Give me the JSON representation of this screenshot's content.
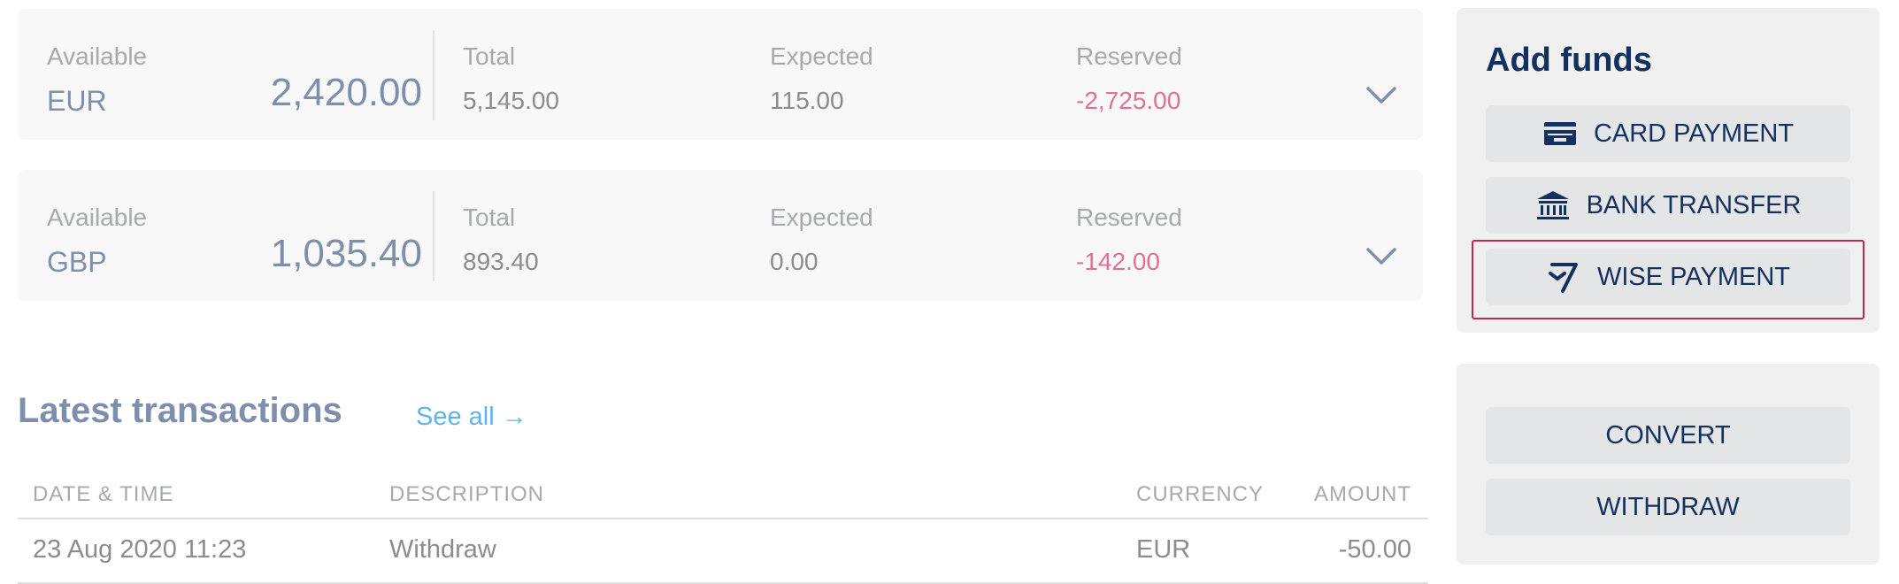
{
  "balances": [
    {
      "available_label": "Available",
      "currency": "EUR",
      "available": "2,420.00",
      "total_label": "Total",
      "total": "5,145.00",
      "expected_label": "Expected",
      "expected": "115.00",
      "reserved_label": "Reserved",
      "reserved": "-2,725.00",
      "expand_icon": "chevron-down-icon"
    },
    {
      "available_label": "Available",
      "currency": "GBP",
      "available": "1,035.40",
      "total_label": "Total",
      "total": "893.40",
      "expected_label": "Expected",
      "expected": "0.00",
      "reserved_label": "Reserved",
      "reserved": "-142.00",
      "expand_icon": "chevron-down-icon"
    }
  ],
  "transactions": {
    "title": "Latest transactions",
    "see_all": "See all →",
    "columns": [
      "DATE & TIME",
      "DESCRIPTION",
      "CURRENCY",
      "AMOUNT"
    ],
    "rows": [
      {
        "datetime": "23 Aug 2020 11:23",
        "description": "Withdraw",
        "currency": "EUR",
        "amount": "-50.00"
      }
    ]
  },
  "add_funds": {
    "title": "Add funds",
    "buttons": [
      {
        "label": "CARD PAYMENT",
        "icon": "card-icon"
      },
      {
        "label": "BANK TRANSFER",
        "icon": "bank-icon"
      },
      {
        "label": "WISE PAYMENT",
        "icon": "wise-icon"
      }
    ]
  },
  "actions": {
    "buttons": [
      {
        "label": "CONVERT"
      },
      {
        "label": "WITHDRAW"
      }
    ]
  },
  "colors": {
    "navy": "#14305e",
    "slate": "#7f8fab",
    "negative": "#e36f93",
    "link": "#5db4ec",
    "highlight": "#c0264e"
  }
}
